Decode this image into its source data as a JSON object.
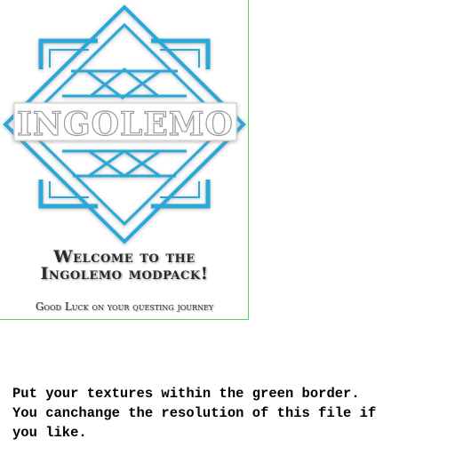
{
  "logo": {
    "brand_text": "INGOLEMO",
    "accent_color": "#2aa9d8"
  },
  "welcome": {
    "line1": "Welcome to the",
    "line2": "Ingolemo modpack!"
  },
  "tagline": "Good Luck on your questing journey",
  "instructions": {
    "line1": "Put your textures within the green border.",
    "line2": "You canchange the resolution of this file if",
    "line3": "you like."
  },
  "border_color": "#4cd94c"
}
